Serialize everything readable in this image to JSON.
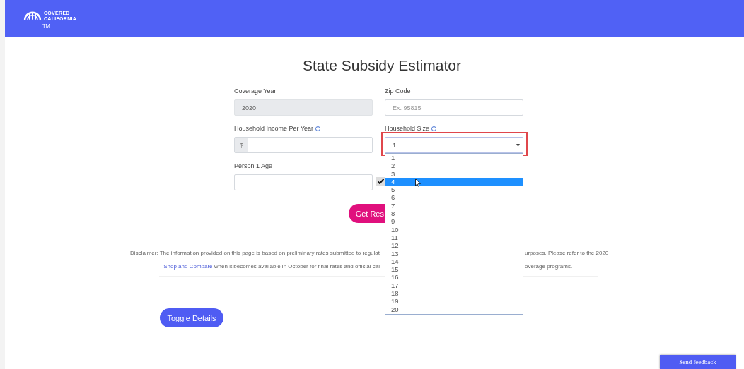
{
  "header": {
    "logo_text": "COVERED",
    "logo_subtext": "CALIFORNIA",
    "logo_mark": "TM"
  },
  "title": "State Subsidy Estimator",
  "fields": {
    "coverage_year": {
      "label": "Coverage Year",
      "value": "2020",
      "disabled": true
    },
    "zip_code": {
      "label": "Zip Code",
      "placeholder": "Ex: 95815"
    },
    "income": {
      "label": "Household Income Per Year",
      "prefix": "$"
    },
    "household_size": {
      "label": "Household Size",
      "value": "1",
      "highlighted": true
    },
    "person_age": {
      "label": "Person 1 Age",
      "checked": true
    }
  },
  "dropdown": {
    "options": [
      {
        "label": "1",
        "selected": false
      },
      {
        "label": "2",
        "selected": false
      },
      {
        "label": "3",
        "selected": false
      },
      {
        "label": "4",
        "selected": true
      },
      {
        "label": "5",
        "selected": false
      },
      {
        "label": "6",
        "selected": false
      },
      {
        "label": "7",
        "selected": false
      },
      {
        "label": "8",
        "selected": false
      },
      {
        "label": "9",
        "selected": false
      },
      {
        "label": "10",
        "selected": false
      },
      {
        "label": "11",
        "selected": false
      },
      {
        "label": "12",
        "selected": false
      },
      {
        "label": "13",
        "selected": false
      },
      {
        "label": "14",
        "selected": false
      },
      {
        "label": "15",
        "selected": false
      },
      {
        "label": "16",
        "selected": false
      },
      {
        "label": "17",
        "selected": false
      },
      {
        "label": "18",
        "selected": false
      },
      {
        "label": "19",
        "selected": false
      },
      {
        "label": "20",
        "selected": false
      }
    ]
  },
  "get_results_button": "Get Res",
  "disclaimer": {
    "line_1_left": "Disclaimer: The information provided on this page is based on preliminary rates submitted to regulat",
    "line_1_right": "urposes. Please refer to the 2020",
    "line_2_link": "Shop and Compare",
    "line_2_left": " when it becomes available in October for final rates and official cal",
    "line_2_right": "overage programs."
  },
  "toggle_button": "Toggle Details",
  "feedback_button": "Send feedback"
}
